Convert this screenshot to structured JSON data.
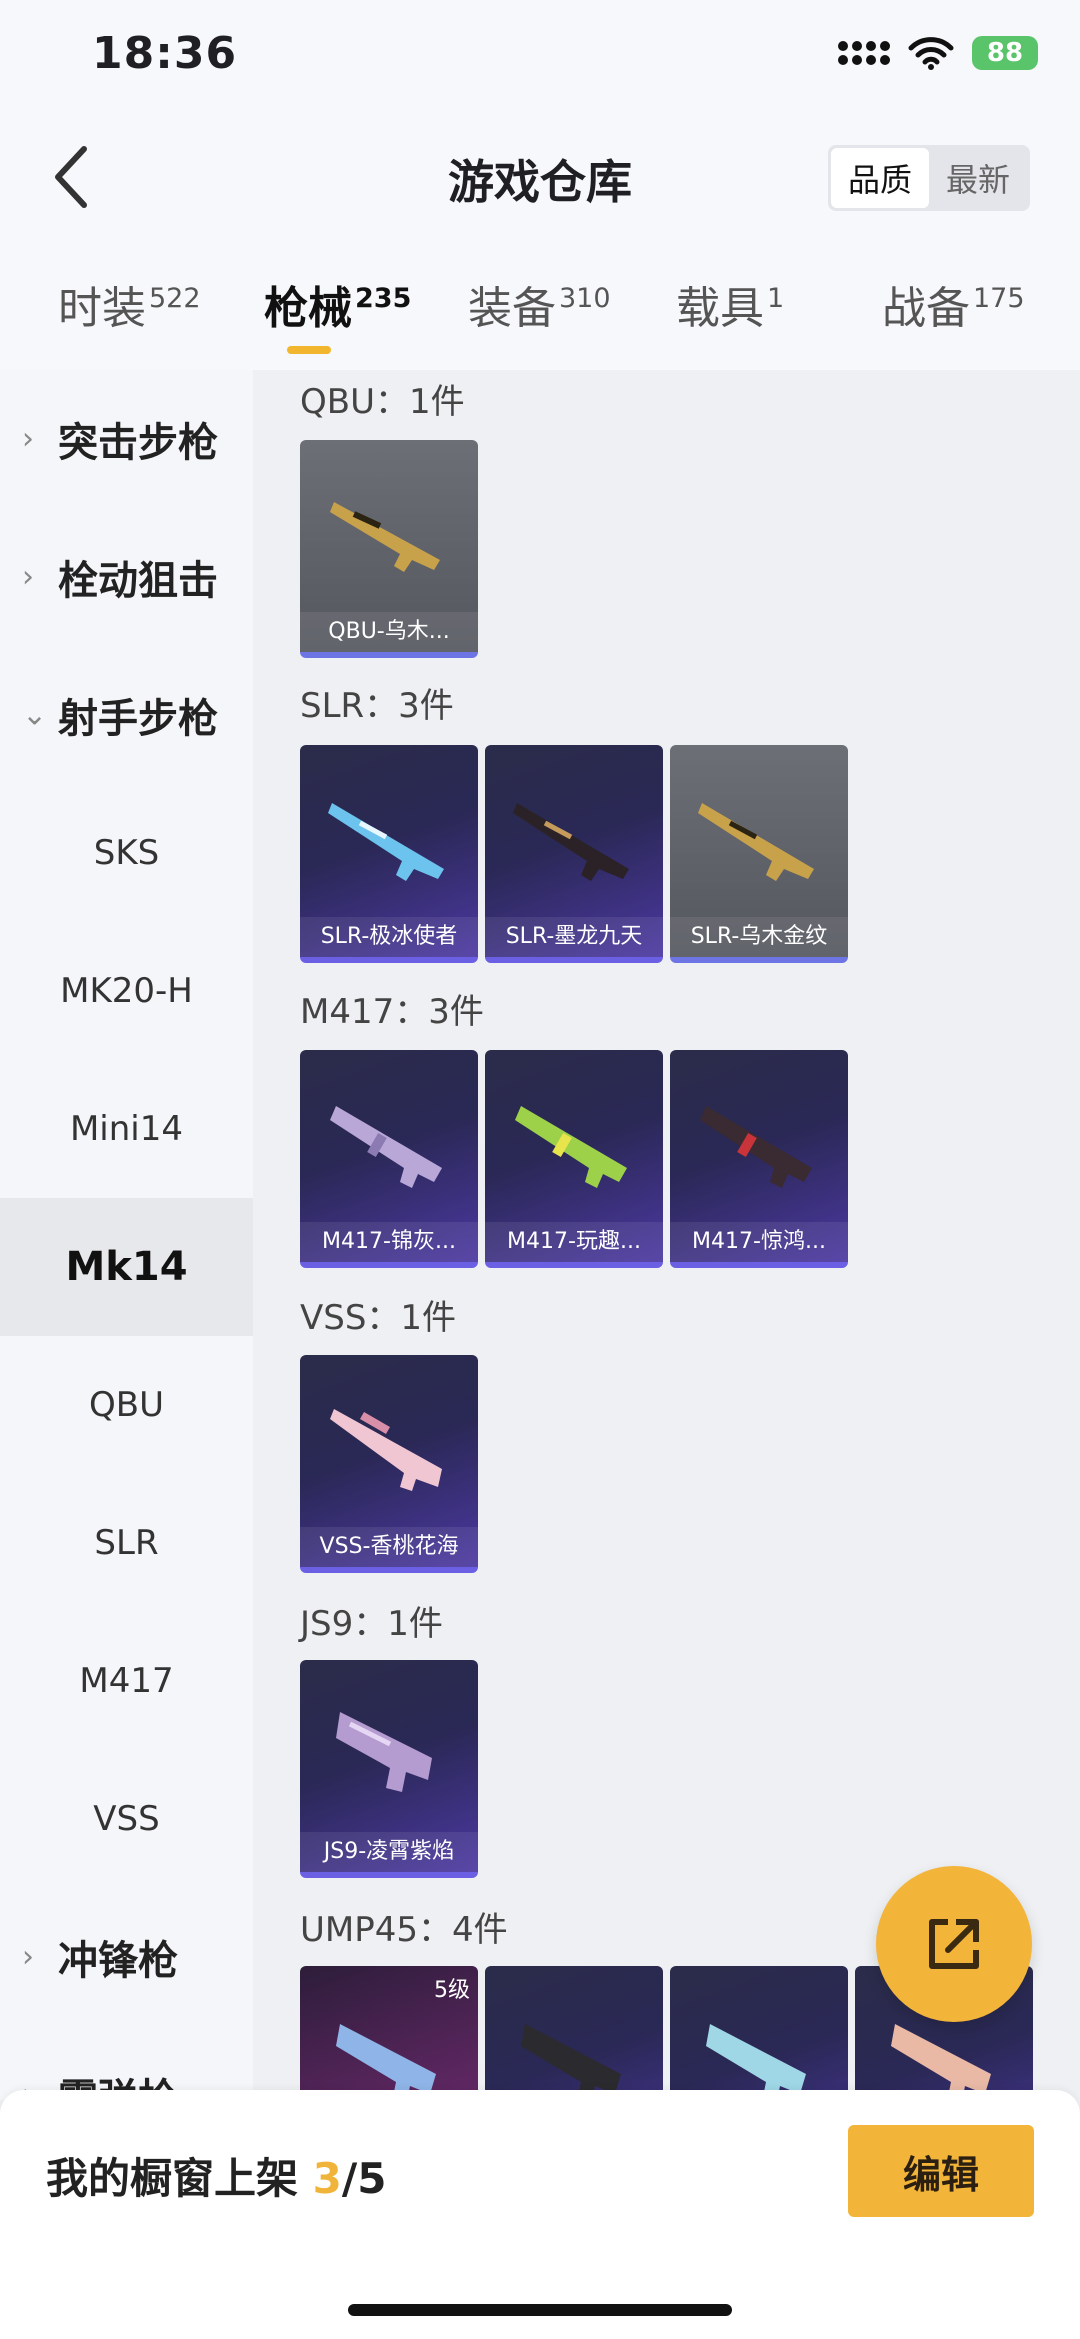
{
  "status": {
    "time": "18:36",
    "battery": "88"
  },
  "header": {
    "title": "游戏仓库",
    "sort": [
      "品质",
      "最新"
    ]
  },
  "tabs": [
    {
      "label": "时装",
      "count": "522"
    },
    {
      "label": "枪械",
      "count": "235"
    },
    {
      "label": "装备",
      "count": "310"
    },
    {
      "label": "载具",
      "count": "1"
    },
    {
      "label": "战备",
      "count": "175"
    }
  ],
  "sidebar": {
    "items": [
      {
        "label": "突击步枪"
      },
      {
        "label": "栓动狙击"
      },
      {
        "label": "射手步枪"
      },
      {
        "label": "SKS"
      },
      {
        "label": "MK20-H"
      },
      {
        "label": "Mini14"
      },
      {
        "label": "Mk14"
      },
      {
        "label": "QBU"
      },
      {
        "label": "SLR"
      },
      {
        "label": "M417"
      },
      {
        "label": "VSS"
      },
      {
        "label": "冲锋枪"
      },
      {
        "label": "霰弹枪"
      }
    ]
  },
  "groups": [
    {
      "label": "QBU：1件",
      "items": [
        {
          "name": "QBU-乌木..."
        }
      ]
    },
    {
      "label": "SLR：3件",
      "items": [
        {
          "name": "SLR-极冰使者"
        },
        {
          "name": "SLR-墨龙九天"
        },
        {
          "name": "SLR-乌木金纹"
        }
      ]
    },
    {
      "label": "M417：3件",
      "items": [
        {
          "name": "M417-锦灰..."
        },
        {
          "name": "M417-玩趣..."
        },
        {
          "name": "M417-惊鸿..."
        }
      ]
    },
    {
      "label": "VSS：1件",
      "items": [
        {
          "name": "VSS-香桃花海"
        }
      ]
    },
    {
      "label": "JS9：1件",
      "items": [
        {
          "name": "JS9-凌霄紫焰"
        }
      ]
    },
    {
      "label": "UMP45：4件",
      "items": [
        {
          "level": "5级"
        }
      ]
    }
  ],
  "footer": {
    "showcase_label": "我的橱窗上架",
    "showcase_count": "3",
    "showcase_total": "/5",
    "edit_label": "编辑"
  },
  "colors": {
    "accent": "#f3b43a",
    "purple_card": "#4b38a1",
    "gray_card": "#5e6068"
  }
}
